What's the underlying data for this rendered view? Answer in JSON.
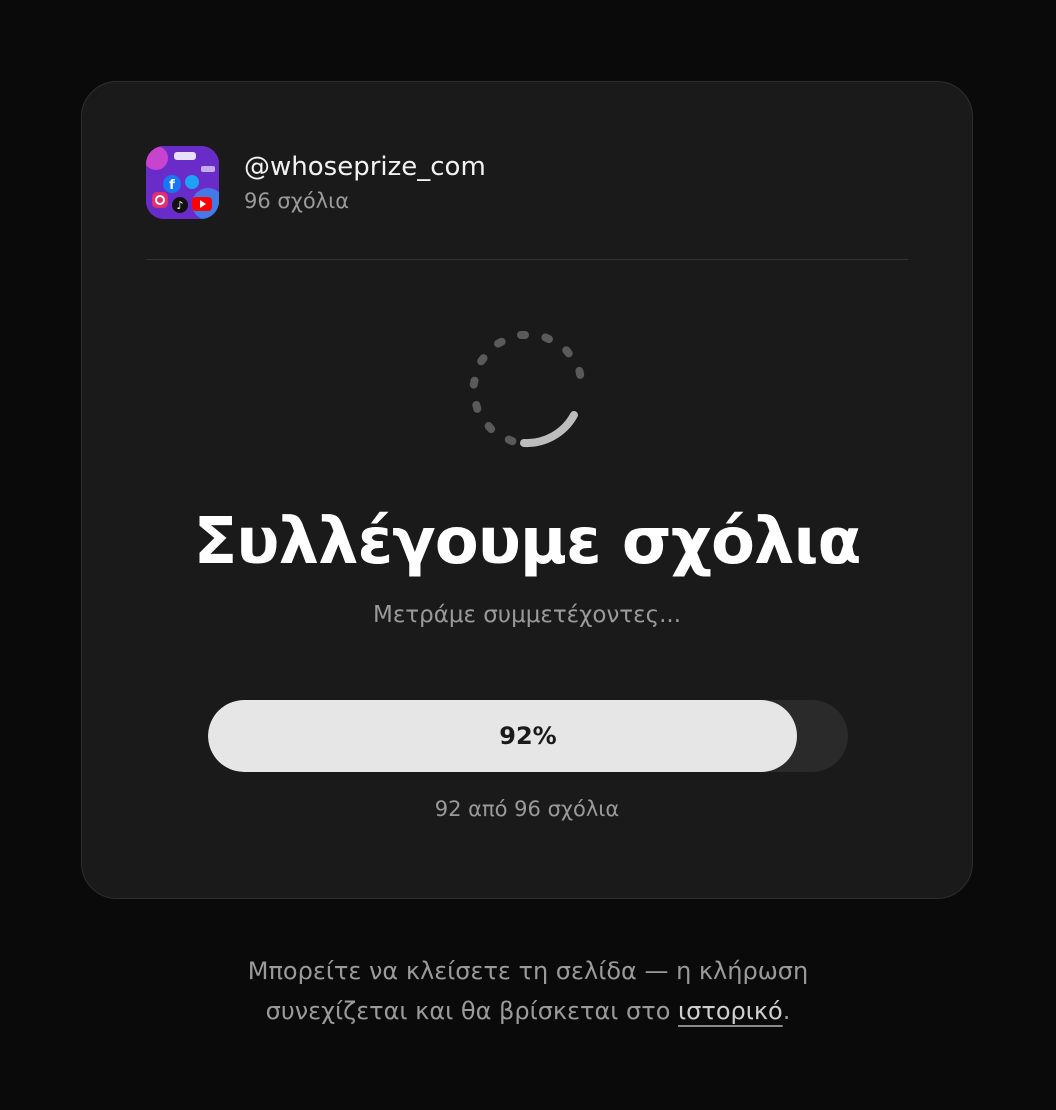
{
  "account": {
    "handle": "@whoseprize_com",
    "comments_count": "96 σχόλια",
    "avatar_icon": "social-media-collage-icon"
  },
  "status": {
    "spinner_icon": "loading-spinner-icon",
    "title": "Συλλέγουμε σχόλια",
    "subtitle": "Μετράμε συμμετέχοντες..."
  },
  "progress": {
    "percent": 92,
    "label": "92%",
    "count_text": "92 από 96 σχόλια"
  },
  "footer": {
    "line1": "Μπορείτε να κλείσετε τη σελίδα — η κλήρωση",
    "line2_prefix": "συνεχίζεται και θα βρίσκεται στο ",
    "history_link": "ιστορικό",
    "line2_suffix": "."
  },
  "colors": {
    "background": "#0a0a0a",
    "card": "#1a1a1a",
    "progress_fill": "#e6e6e6",
    "progress_track": "#2a2a2a"
  }
}
